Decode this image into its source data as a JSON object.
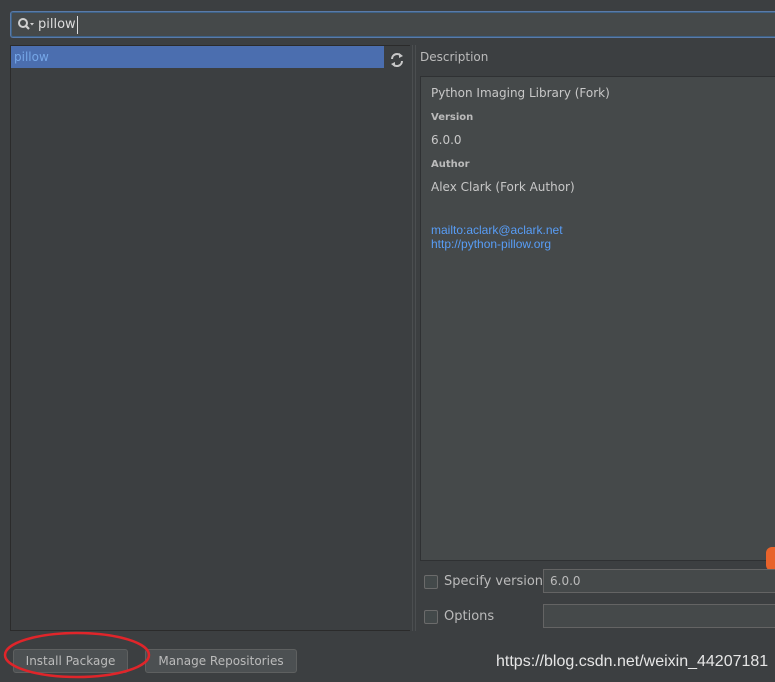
{
  "search": {
    "value": "pillow",
    "icon": "search-icon"
  },
  "packages": {
    "items": [
      {
        "name": "pillow",
        "selected": true
      }
    ]
  },
  "description": {
    "header": "Description",
    "summary": "Python Imaging Library (Fork)",
    "version_label": "Version",
    "version": "6.0.0",
    "author_label": "Author",
    "author": "Alex Clark (Fork Author)",
    "links": [
      "mailto:aclark@aclark.net",
      "http://python-pillow.org"
    ]
  },
  "options": {
    "specify_version_label": "Specify version",
    "specify_version_value": "6.0.0",
    "options_label": "Options",
    "options_value": ""
  },
  "buttons": {
    "install": "Install Package",
    "manage": "Manage Repositories"
  },
  "watermark": "https://blog.csdn.net/weixin_44207181",
  "colors": {
    "background": "#3c3f41",
    "selection": "#4b6eaf",
    "link": "#589df6",
    "highlight_circle": "#e0252a"
  }
}
